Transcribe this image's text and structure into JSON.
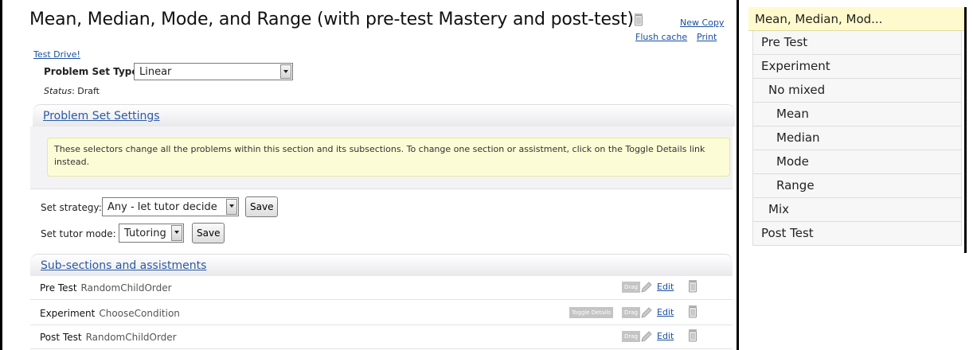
{
  "title": "Mean, Median, Mode, and Range (with pre-test Mastery and post-test)",
  "links": {
    "new_copy": "New Copy",
    "flush_cache": "Flush cache",
    "print": "Print",
    "test_drive": "Test Drive!"
  },
  "problem_set_type": {
    "label": "Problem Set Type:",
    "value": "Linear"
  },
  "status": {
    "label": "Status",
    "value": ": Draft"
  },
  "settings": {
    "header": "Problem Set Settings",
    "note": "These selectors change all the problems within this section and its subsections. To change one section or assistment, click on the Toggle Details link instead.",
    "strategy_label": "Set strategy:",
    "strategy_value": "Any - let tutor decide",
    "mode_label": "Set tutor mode:",
    "mode_value": "Tutoring",
    "save_label": "Save"
  },
  "subsections": {
    "header": "Sub-sections and assistments",
    "drag_label": "Drag",
    "edit_label": "Edit",
    "toggle_label": "Toggle Details",
    "rows": [
      {
        "name": "Pre Test",
        "type": "RandomChildOrder"
      },
      {
        "name": "Experiment",
        "type": "ChooseCondition"
      },
      {
        "name": "Post Test",
        "type": "RandomChildOrder"
      }
    ]
  },
  "nav": {
    "root": "Mean, Median, Mod...",
    "items": [
      {
        "label": "Pre Test"
      },
      {
        "label": "Experiment"
      },
      {
        "label": "No mixed"
      },
      {
        "label": "Mean"
      },
      {
        "label": "Median"
      },
      {
        "label": "Mode"
      },
      {
        "label": "Range"
      },
      {
        "label": "Mix"
      },
      {
        "label": "Post Test"
      }
    ]
  },
  "icons": {
    "trash": "trash-icon",
    "pencil": "pencil-icon",
    "dropdown": "chevron-down-icon"
  },
  "colors": {
    "link": "#1a4fa0",
    "note_bg": "#fcfcd6",
    "nav_root_bg": "#fffacd"
  }
}
